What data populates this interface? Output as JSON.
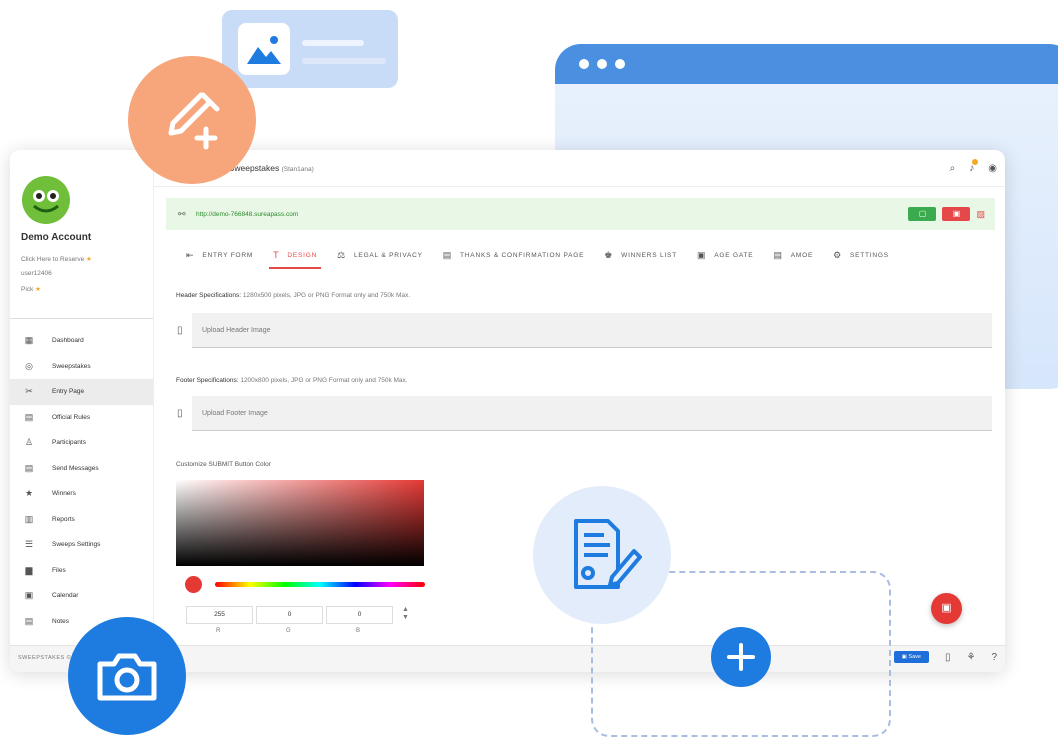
{
  "app": {
    "title": "Web Sweepstakes",
    "subtitle": "(Stan1ana)",
    "url": "http://demo-766848.sureapass.com"
  },
  "account": {
    "name": "Demo Account",
    "lines": [
      "Click Here to Reserve",
      "user12406",
      "Pick"
    ]
  },
  "menu": [
    {
      "label": "Dashboard",
      "icon": "dashboard-icon",
      "glyph": "▦"
    },
    {
      "label": "Sweepstakes",
      "icon": "sweepstakes-icon",
      "glyph": "◎"
    },
    {
      "label": "Entry Page",
      "icon": "tools-icon",
      "glyph": "✂"
    },
    {
      "label": "Official Rules",
      "icon": "rules-icon",
      "glyph": "▤"
    },
    {
      "label": "Participants",
      "icon": "participants-icon",
      "glyph": "♙"
    },
    {
      "label": "Send Messages",
      "icon": "messages-icon",
      "glyph": "▤"
    },
    {
      "label": "Winners",
      "icon": "winners-icon",
      "glyph": "★"
    },
    {
      "label": "Reports",
      "icon": "reports-icon",
      "glyph": "▥"
    },
    {
      "label": "Sweeps Settings",
      "icon": "settings-list-icon",
      "glyph": "☰"
    },
    {
      "label": "Files",
      "icon": "files-icon",
      "glyph": "▆"
    },
    {
      "label": "Calendar",
      "icon": "calendar-icon",
      "glyph": "▣"
    },
    {
      "label": "Notes",
      "icon": "notes-icon",
      "glyph": "▤"
    }
  ],
  "tabs": [
    {
      "label": "ENTRY FORM",
      "icon": "entry-form-icon",
      "glyph": "⇤",
      "active": false
    },
    {
      "label": "DESIGN",
      "icon": "design-icon",
      "glyph": "T",
      "active": true
    },
    {
      "label": "LEGAL & PRIVACY",
      "icon": "legal-icon",
      "glyph": "⚖",
      "active": false
    },
    {
      "label": "THANKS & CONFIRMATION PAGE",
      "icon": "thanks-icon",
      "glyph": "▤",
      "active": false
    },
    {
      "label": "WINNERS LIST",
      "icon": "winners-list-icon",
      "glyph": "♚",
      "active": false
    },
    {
      "label": "AGE GATE",
      "icon": "age-gate-icon",
      "glyph": "▣",
      "active": false
    },
    {
      "label": "AMOE",
      "icon": "amoe-icon",
      "glyph": "▤",
      "active": false
    },
    {
      "label": "SETTINGS",
      "icon": "settings-icon",
      "glyph": "⚙",
      "active": false
    }
  ],
  "design": {
    "header_spec_label": "Header Specifications:",
    "header_spec_text": "1280x500 pixels, JPG or PNG Format only and 750k Max.",
    "header_upload": "Upload Header Image",
    "footer_spec_label": "Footer Specifications:",
    "footer_spec_text": "1200x800 pixels, JPG or PNG Format only and 750k Max.",
    "footer_upload": "Upload Footer Image",
    "color_label": "Customize SUBMIT Button Color",
    "rgb": {
      "r": "255",
      "g": "0",
      "b": "0"
    },
    "rgb_labels": {
      "r": "R",
      "g": "G",
      "b": "B"
    },
    "selected_color": "#e53935"
  },
  "footer": {
    "brand": "SWEEPSTAKES ©",
    "save_label": "Save"
  },
  "colors": {
    "accent_red": "#e53935",
    "accent_blue": "#1e7be0",
    "url_green": "#2e8b2e"
  }
}
